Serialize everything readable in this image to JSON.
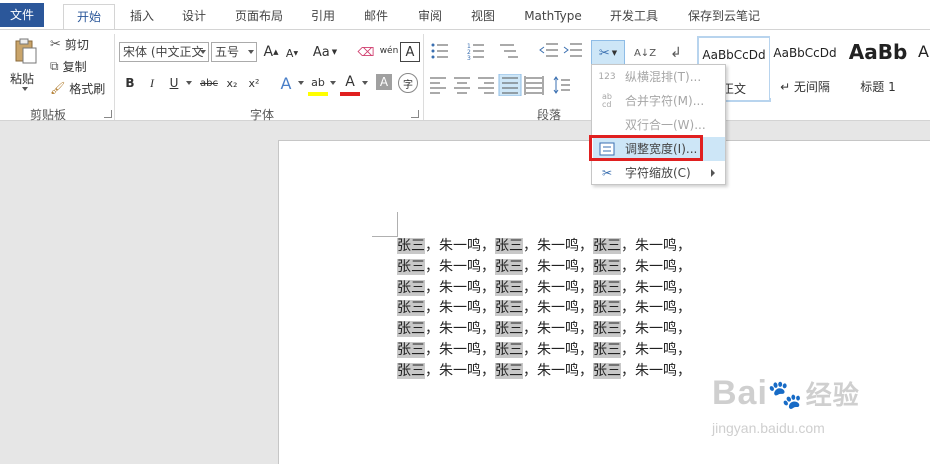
{
  "tabs": [
    {
      "label": "文件",
      "kind": "file"
    },
    {
      "label": "开始",
      "kind": "active"
    },
    {
      "label": "插入"
    },
    {
      "label": "设计"
    },
    {
      "label": "页面布局"
    },
    {
      "label": "引用"
    },
    {
      "label": "邮件"
    },
    {
      "label": "审阅"
    },
    {
      "label": "视图"
    },
    {
      "label": "MathType"
    },
    {
      "label": "开发工具"
    },
    {
      "label": "保存到云笔记"
    }
  ],
  "clipboard": {
    "paste_label": "粘贴",
    "cut_label": "剪切",
    "copy_label": "复制",
    "format_painter_label": "格式刷",
    "group_label": "剪贴板"
  },
  "font": {
    "font_name": "宋体 (中文正文",
    "font_size": "五号",
    "group_label": "字体",
    "grow_label": "A",
    "shrink_label": "A",
    "case_label": "Aa",
    "bold": "B",
    "italic": "I",
    "underline": "U",
    "strike": "abc",
    "subscript": "x₂",
    "superscript": "x²",
    "text_effect": "A",
    "highlight": "ab",
    "font_color": "A",
    "char_shading": "A",
    "enclose": "字",
    "pinyin": "wén",
    "border": "A"
  },
  "paragraph": {
    "group_label": "段落"
  },
  "styles": {
    "items": [
      {
        "sample": "AaBbCcDd",
        "name": "正文"
      },
      {
        "sample": "AaBbCcDd",
        "name": "↵ 无间隔"
      },
      {
        "sample": "AaBb",
        "name": "标题 1"
      },
      {
        "sample": "A",
        "name": ""
      }
    ]
  },
  "menu": {
    "items": [
      {
        "label": "纵横混排(T)...",
        "icon": "vertical-horizontal-icon",
        "disabled": true
      },
      {
        "label": "合并字符(M)...",
        "icon": "combine-chars-icon",
        "disabled": true
      },
      {
        "label": "双行合一(W)...",
        "icon": "two-lines-in-one-icon",
        "disabled": true
      },
      {
        "label": "调整宽度(I)...",
        "icon": "adjust-width-icon",
        "disabled": false
      },
      {
        "label": "字符缩放(C)",
        "icon": "char-scale-icon",
        "disabled": false
      }
    ],
    "highlight_color": "#e02020"
  },
  "document": {
    "lines": [
      [
        "张三",
        "，朱一鸣，",
        "张三",
        "，朱一鸣，",
        "张三",
        "，朱一鸣，"
      ],
      [
        "张三",
        "，朱一鸣，",
        "张三",
        "，朱一鸣，",
        "张三",
        "，朱一鸣，"
      ],
      [
        "张三",
        "，朱一鸣，",
        "张三",
        "，朱一鸣，",
        "张三",
        "，朱一鸣，"
      ],
      [
        "张三",
        "，朱一鸣，",
        "张三",
        "，朱一鸣，",
        "张三",
        "，朱一鸣，"
      ],
      [
        "张三",
        "，朱一鸣，",
        "张三",
        "，朱一鸣，",
        "张三",
        "，朱一鸣，"
      ],
      [
        "张三",
        "，朱一鸣，",
        "张三",
        "，朱一鸣，",
        "张三",
        "，朱一鸣，"
      ],
      [
        "张三",
        "，朱一鸣，",
        "张三",
        "，朱一鸣，",
        "张三",
        "，朱一鸣，"
      ]
    ]
  },
  "watermark": {
    "brand": "Bai",
    "brand2": "经验",
    "url": "jingyan.baidu.com"
  },
  "colors": {
    "file_tab": "#2b579a",
    "highlight": "#c8c8c8",
    "menu_active": "#cde6f7"
  }
}
